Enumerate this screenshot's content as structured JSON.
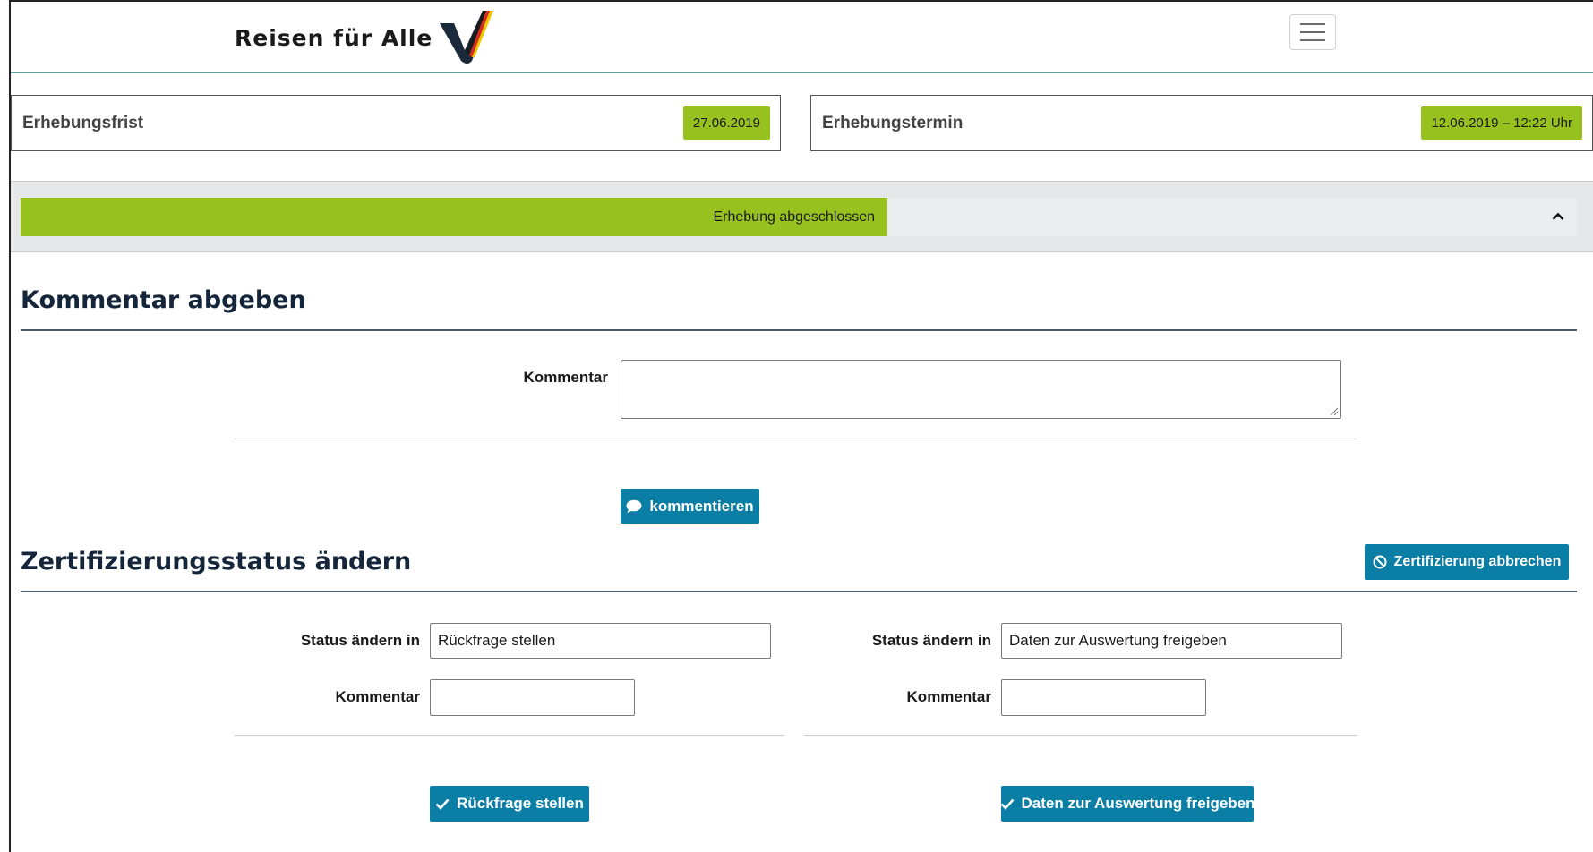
{
  "header": {
    "brand": "Reisen für Alle",
    "menu_icon": "hamburger-icon"
  },
  "info": {
    "deadline_label": "Erhebungsfrist",
    "deadline_value": "27.06.2019",
    "appointment_label": "Erhebungstermin",
    "appointment_value": "12.06.2019 – 12:22 Uhr"
  },
  "status": {
    "label": "Erhebung abgeschlossen",
    "progress_fraction": 0.557,
    "color": "#97c11f",
    "toggle_icon": "chevron-up-icon"
  },
  "comment_section": {
    "title": "Kommentar abgeben",
    "field_label": "Kommentar",
    "field_value": "",
    "button_label": "kommentieren",
    "button_icon": "speech-bubble-icon"
  },
  "cert_section": {
    "title": "Zertifizierungsstatus ändern",
    "cancel_button_label": "Zertifizierung abbrechen",
    "cancel_icon": "prohibited-icon",
    "left": {
      "status_label": "Status ändern in",
      "status_value": "Rückfrage stellen",
      "comment_label": "Kommentar",
      "comment_value": "",
      "button_label": "Rückfrage stellen",
      "button_icon": "check-icon"
    },
    "right": {
      "status_label": "Status ändern in",
      "status_value": "Daten zur Auswertung freigeben",
      "comment_label": "Kommentar",
      "comment_value": "",
      "button_label": "Daten zur Auswertung freigeben",
      "button_icon": "check-icon"
    }
  },
  "colors": {
    "accent_green": "#97c11f",
    "button_blue": "#0a7ea4",
    "heading_navy": "#15263a"
  }
}
